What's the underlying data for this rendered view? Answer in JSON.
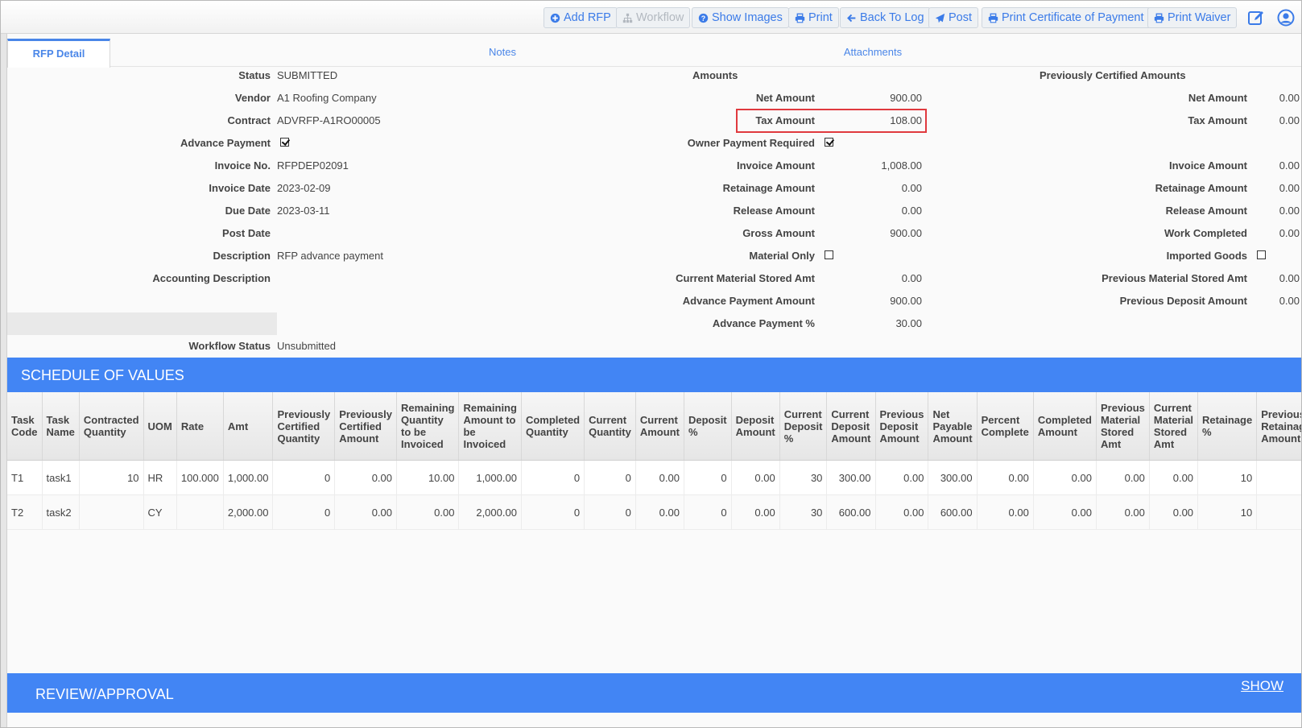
{
  "toolbar": {
    "buttons": [
      {
        "label": "Add RFP",
        "icon": "plus-circle-icon",
        "enabled": true
      },
      {
        "label": "Workflow",
        "icon": "sitemap-icon",
        "enabled": false
      },
      {
        "label": "Show Images",
        "icon": "question-circle-icon",
        "enabled": true
      },
      {
        "label": "Print",
        "icon": "print-icon",
        "enabled": true
      },
      {
        "label": "Back To Log",
        "icon": "arrow-left-icon",
        "enabled": true
      },
      {
        "label": "Post",
        "icon": "paper-plane-icon",
        "enabled": true
      },
      {
        "label": "Print Certificate of Payment",
        "icon": "print-icon",
        "enabled": true
      },
      {
        "label": "Print Waiver",
        "icon": "print-icon",
        "enabled": true
      }
    ],
    "edit_icon": "edit-icon",
    "user_icon": "user-circle-icon"
  },
  "tabs": [
    {
      "label": "RFP Detail",
      "active": true
    },
    {
      "label": "Notes",
      "active": false
    },
    {
      "label": "Attachments",
      "active": false
    }
  ],
  "details": {
    "status_label": "Status",
    "status": "SUBMITTED",
    "vendor_label": "Vendor",
    "vendor": "A1 Roofing Company",
    "contract_label": "Contract",
    "contract": "ADVRFP-A1RO00005",
    "advance_payment_label": "Advance Payment",
    "advance_payment": true,
    "invoice_no_label": "Invoice No.",
    "invoice_no": "RFPDEP02091",
    "invoice_date_label": "Invoice Date",
    "invoice_date": "2023-02-09",
    "due_date_label": "Due Date",
    "due_date": "2023-03-11",
    "post_date_label": "Post Date",
    "post_date": "",
    "description_label": "Description",
    "description": "RFP advance payment",
    "accounting_description_label": "Accounting Description",
    "accounting_description": "",
    "workflow_status_label": "Workflow Status",
    "workflow_status": "Unsubmitted"
  },
  "amounts": {
    "heading": "Amounts",
    "net_amount_label": "Net Amount",
    "net_amount": "900.00",
    "tax_amount_label": "Tax Amount",
    "tax_amount": "108.00",
    "owner_payment_required_label": "Owner Payment Required",
    "owner_payment_required": true,
    "invoice_amount_label": "Invoice Amount",
    "invoice_amount": "1,008.00",
    "retainage_amount_label": "Retainage Amount",
    "retainage_amount": "0.00",
    "release_amount_label": "Release Amount",
    "release_amount": "0.00",
    "gross_amount_label": "Gross Amount",
    "gross_amount": "900.00",
    "material_only_label": "Material Only",
    "material_only": false,
    "current_material_stored_label": "Current Material Stored Amt",
    "current_material_stored": "0.00",
    "advance_payment_amount_label": "Advance Payment Amount",
    "advance_payment_amount": "900.00",
    "advance_payment_pct_label": "Advance Payment %",
    "advance_payment_pct": "30.00",
    "highlight_color": "#e0393e"
  },
  "previous": {
    "heading": "Previously Certified Amounts",
    "net_amount_label": "Net Amount",
    "net_amount": "0.00",
    "tax_amount_label": "Tax Amount",
    "tax_amount": "0.00",
    "invoice_amount_label": "Invoice Amount",
    "invoice_amount": "0.00",
    "retainage_amount_label": "Retainage Amount",
    "retainage_amount": "0.00",
    "release_amount_label": "Release Amount",
    "release_amount": "0.00",
    "work_completed_label": "Work Completed",
    "work_completed": "0.00",
    "imported_goods_label": "Imported Goods",
    "imported_goods": false,
    "previous_material_stored_label": "Previous Material Stored Amt",
    "previous_material_stored": "0.00",
    "previous_deposit_label": "Previous Deposit Amount",
    "previous_deposit": "0.00"
  },
  "sov": {
    "title": "SCHEDULE OF VALUES",
    "columns": [
      "Task Code",
      "Task Name",
      "Contracted Quantity",
      "UOM",
      "Rate",
      "Amt",
      "Previously Certified Quantity",
      "Previously Certified Amount",
      "Remaining Quantity to be Invoiced",
      "Remaining Amount to be Invoiced",
      "Completed Quantity",
      "Current Quantity",
      "Current Amount",
      "Deposit %",
      "Deposit Amount",
      "Current Deposit %",
      "Current Deposit Amount",
      "Previous Deposit Amount",
      "Net Payable Amount",
      "Percent Complete",
      "Completed Amount",
      "Previous Material Stored Amt",
      "Current Material Stored Amt",
      "Retainage %",
      "Previous Retainage Amount"
    ],
    "rows": [
      [
        "T1",
        "task1",
        "10",
        "HR",
        "100.000",
        "1,000.00",
        "0",
        "0.00",
        "10.00",
        "1,000.00",
        "0",
        "0",
        "0.00",
        "0",
        "0.00",
        "30",
        "300.00",
        "0.00",
        "300.00",
        "0.00",
        "0.00",
        "0.00",
        "0.00",
        "10",
        ""
      ],
      [
        "T2",
        "task2",
        "",
        "CY",
        "",
        "2,000.00",
        "0",
        "0.00",
        "0.00",
        "2,000.00",
        "0",
        "0",
        "0.00",
        "0",
        "0.00",
        "30",
        "600.00",
        "0.00",
        "600.00",
        "0.00",
        "0.00",
        "0.00",
        "0.00",
        "10",
        ""
      ]
    ]
  },
  "review": {
    "title": "REVIEW/APPROVAL",
    "show_label": "SHOW"
  },
  "colors": {
    "accent": "#4285f4",
    "link": "#3b7be8"
  }
}
